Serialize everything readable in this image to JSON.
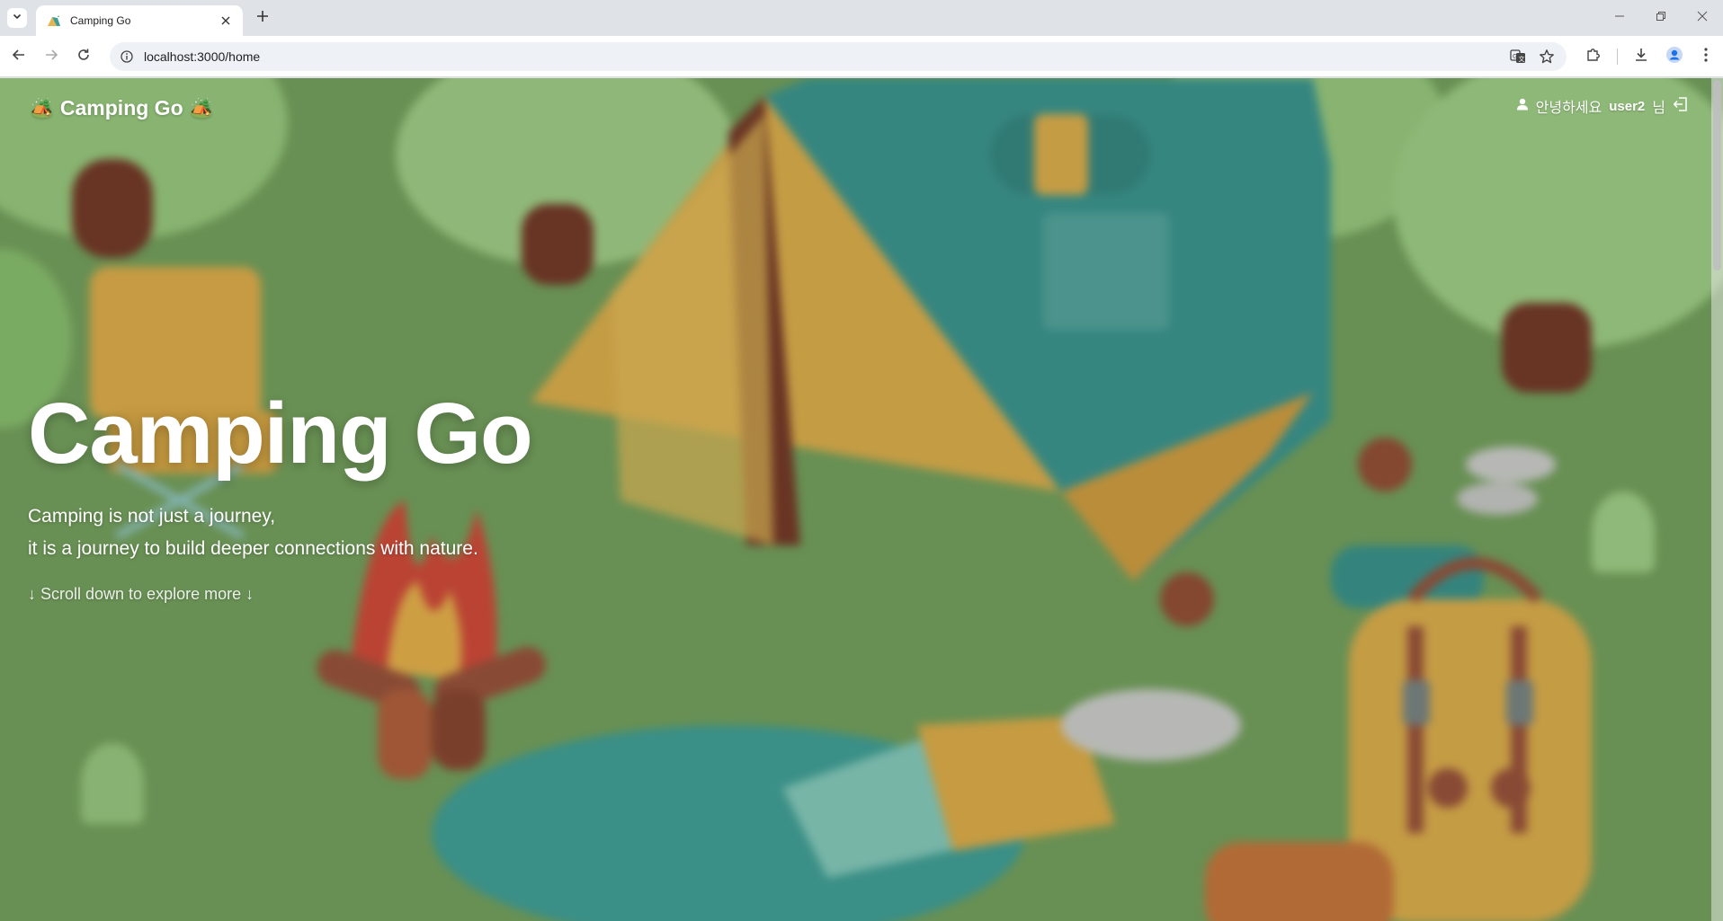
{
  "browser": {
    "tab": {
      "title": "Camping Go"
    },
    "url": "localhost:3000/home"
  },
  "icons": {
    "tab_list": "chevron-down-icon",
    "close": "close-icon",
    "new_tab": "plus-icon",
    "back": "back-arrow-icon",
    "forward": "forward-arrow-icon",
    "reload": "reload-icon",
    "site_info": "info-icon",
    "translate": "translate-icon",
    "bookmark": "star-icon",
    "extensions": "puzzle-icon",
    "downloads": "download-icon",
    "profile": "profile-icon",
    "menu": "kebab-menu-icon",
    "user": "user-icon",
    "logout": "logout-icon"
  },
  "header": {
    "logo_text": "Camping Go",
    "logo_emoji_left": "🏕️",
    "logo_emoji_right": "🏕️",
    "greeting": "안녕하세요",
    "username": "user2",
    "honorific": "님"
  },
  "hero": {
    "title": "Camping Go",
    "subtitle_line1": "Camping is not just a journey,",
    "subtitle_line2": "it is a journey to build deeper connections with nature.",
    "scroll_hint": "↓ Scroll down to explore more ↓"
  },
  "colors": {
    "grass": "#7aa862",
    "tent_teal": "#3f9d95",
    "tent_yellow": "#e5b650",
    "tree_green": "#9ccf7f",
    "trunk": "#7a3d2a"
  }
}
